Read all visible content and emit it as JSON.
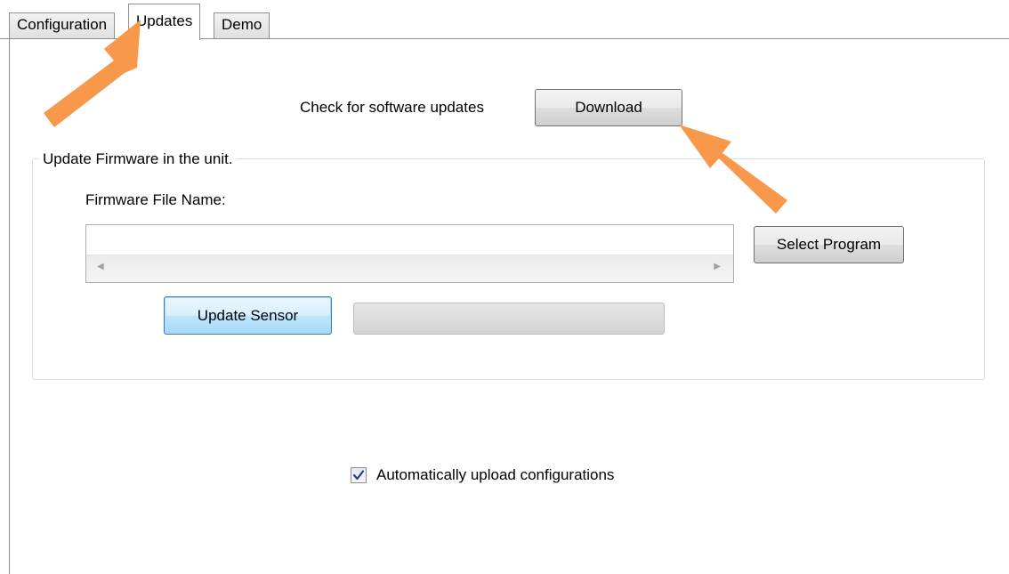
{
  "tabs": [
    {
      "label": "Configuration",
      "active": false
    },
    {
      "label": "Updates",
      "active": true
    },
    {
      "label": "Demo",
      "active": false
    }
  ],
  "updates": {
    "check_label": "Check for software updates",
    "download_button": "Download",
    "group_title": "Update Firmware in the unit.",
    "firmware_label": "Firmware File Name:",
    "firmware_value": "",
    "select_program_button": "Select Program",
    "update_sensor_button": "Update Sensor",
    "progress_fraction": 0,
    "auto_upload_label": "Automatically upload configurations",
    "auto_upload_checked": true
  },
  "annotations": {
    "arrow_color": "#f7984a"
  },
  "icons": {
    "scroll_left": "scroll-left-arrow-icon",
    "scroll_right": "scroll-right-arrow-icon",
    "check": "checkmark-icon"
  }
}
